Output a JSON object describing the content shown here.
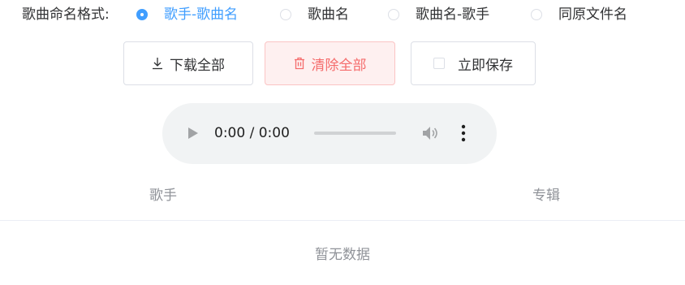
{
  "naming": {
    "label": "歌曲命名格式:",
    "options": [
      {
        "label": "歌手-歌曲名",
        "checked": true
      },
      {
        "label": "歌曲名",
        "checked": false
      },
      {
        "label": "歌曲名-歌手",
        "checked": false
      },
      {
        "label": "同原文件名",
        "checked": false
      }
    ]
  },
  "actions": {
    "download_all": "下载全部",
    "clear_all": "清除全部",
    "save_now": "立即保存"
  },
  "player": {
    "time": "0:00 / 0:00",
    "progress": 0
  },
  "table": {
    "columns": [
      "歌手",
      "专辑"
    ],
    "empty_text": "暂无数据"
  },
  "colors": {
    "primary": "#409eff",
    "danger": "#f56c6c",
    "danger_bg": "#fef0f0",
    "muted": "#909399"
  },
  "icons": {
    "download": "download-icon",
    "clear": "trash-icon",
    "play": "play-icon",
    "volume": "volume-icon",
    "more": "more-vertical-icon"
  }
}
